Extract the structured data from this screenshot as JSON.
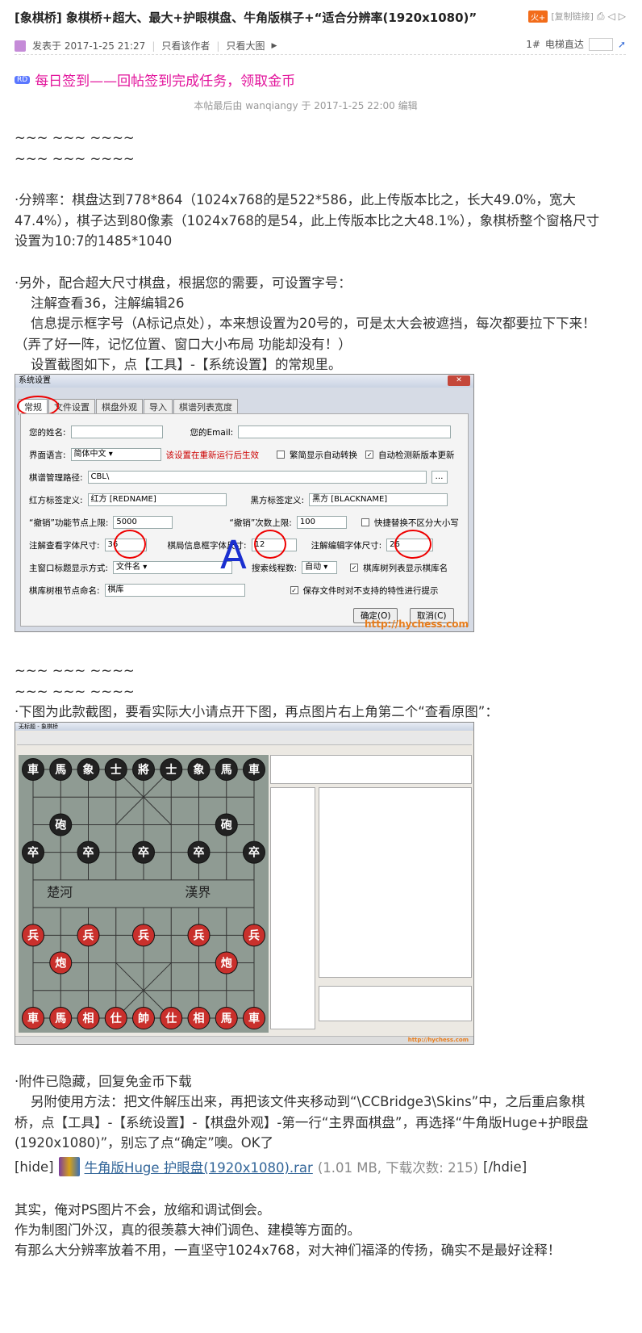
{
  "thread": {
    "title": "[象棋桥] 象棋桥+超大、最大+护眼棋盘、牛角版棋子+“适合分辨率(1920x1080)”",
    "hot_badge": "火+",
    "copy_link": "[复制链接]"
  },
  "post": {
    "posted_at": "发表于 2017-1-25 21:27",
    "only_author": "只看该作者",
    "only_big_image": "只看大图",
    "floor": "1#",
    "elevator": "电梯直达",
    "signin_tag": "RD",
    "signin_text": "每日签到——回帖签到完成任务，领取金币",
    "edited_note": "本帖最后由 wanqiangy 于 2017-1-25 22:00 编辑"
  },
  "body": {
    "tilde1": "~~~ ~~~ ~~~~",
    "tilde2": "~~~ ~~~ ~~~~",
    "para1": "·分辨率：棋盘达到778*864（1024x768的是522*586，此上传版本比之，长大49.0%，宽大47.4%），棋子达到80像素（1024x768的是54，此上传版本比之大48.1%），象棋桥整个窗格尺寸设置为10:7的1485*1040",
    "para2": "·另外，配合超大尺寸棋盘，根据您的需要，可设置字号：",
    "para3": "注解查看36，注解编辑26",
    "para4": "信息提示框字号（A标记点处），本来想设置为20号的，可是太大会被遮挡，每次都要拉下下来！（弄了好一阵，记忆位置、窗口大小布局 功能却没有！）",
    "para5": "设置截图如下，点【工具】-【系统设置】的常规里。",
    "tilde3": "~~~ ~~~ ~~~~",
    "tilde4": "~~~ ~~~ ~~~~",
    "para6": "·下图为此款截图，要看实际大小请点开下图，再点图片右上角第二个“查看原图”：",
    "para7": "·附件已隐藏，回复免金币下载",
    "para8": "另附使用方法：把文件解压出来，再把该文件夹移动到“\\CCBridge3\\Skins”中，之后重启象棋桥，点【工具】-【系统设置】-【棋盘外观】-第一行“主界面棋盘”，再选择“牛角版Huge+护眼盘(1920x1080)”，别忘了点“确定”噢。OK了",
    "hide_open": "[hide]",
    "attach_name": "牛角版Huge 护眼盘(1920x1080).rar",
    "attach_meta": "(1.01 MB, 下载次数: 215)",
    "hide_close": "[/hdie]",
    "para9": "其实，俺对PS图片不会，放缩和调试倒会。",
    "para10": "作为制图门外汉，真的很羡慕大神们调色、建模等方面的。",
    "para11": "有那么大分辨率放着不用，一直坚守1024x768，对大神们福泽的传扬，确实不是最好诠释！"
  },
  "settings_dialog": {
    "title": "系统设置",
    "tabs": [
      "常规",
      "文件设置",
      "棋盘外观",
      "导入",
      "棋谱列表宽度"
    ],
    "your_name_label": "您的姓名:",
    "your_email_label": "您的Email:",
    "ui_lang_label": "界面语言:",
    "ui_lang_value": "简体中文",
    "ui_lang_note": "该设置在重新运行后生效",
    "chk_trad": "繁简显示自动转换",
    "chk_update": "自动检测新版本更新",
    "path_label": "棋谱管理路径:",
    "path_value": "CBL\\",
    "red_label": "红方标签定义:",
    "red_value": "红方 [REDNAME]",
    "black_label": "黑方标签定义:",
    "black_value": "黑方 [BLACKNAME]",
    "undo_nodes_label": "“撤销”功能节点上限:",
    "undo_nodes_value": "5000",
    "undo_count_label": "“撤销”次数上限:",
    "undo_count_value": "100",
    "chk_case": "快捷替换不区分大小写",
    "note_view_label": "注解查看字体尺寸:",
    "note_view_value": "36",
    "info_label": "棋局信息框字体尺寸:",
    "info_value": "12",
    "note_edit_label": "注解编辑字体尺寸:",
    "note_edit_value": "26",
    "title_mode_label": "主窗口标题显示方式:",
    "title_mode_value": "文件名",
    "threads_label": "搜索线程数:",
    "threads_value": "自动",
    "chk_libname": "棋库树列表显示棋库名",
    "root_label": "棋库树根节点命名:",
    "root_value": "棋库",
    "chk_save": "保存文件时对不支持的特性进行提示",
    "ok": "确定(O)",
    "cancel": "取消(C)",
    "watermark": "http://hychess.com",
    "annotation": "A"
  },
  "board_shot": {
    "window_title": "无标题 - 象棋桥",
    "river_left": "楚河",
    "river_right": "漢界",
    "top_row": [
      "車",
      "馬",
      "象",
      "士",
      "將",
      "士",
      "象",
      "馬",
      "車"
    ],
    "black_cannons": [
      "砲",
      "砲"
    ],
    "black_pawns": [
      "卒",
      "卒",
      "卒",
      "卒",
      "卒"
    ],
    "red_pawns": [
      "兵",
      "兵",
      "兵",
      "兵",
      "兵"
    ],
    "red_cannons": [
      "炮",
      "炮"
    ],
    "bottom_row": [
      "車",
      "馬",
      "相",
      "仕",
      "帥",
      "仕",
      "相",
      "馬",
      "車"
    ],
    "watermark": "http://hychess.com"
  },
  "colors": {
    "accent": "#e2139b",
    "link": "#336699"
  }
}
